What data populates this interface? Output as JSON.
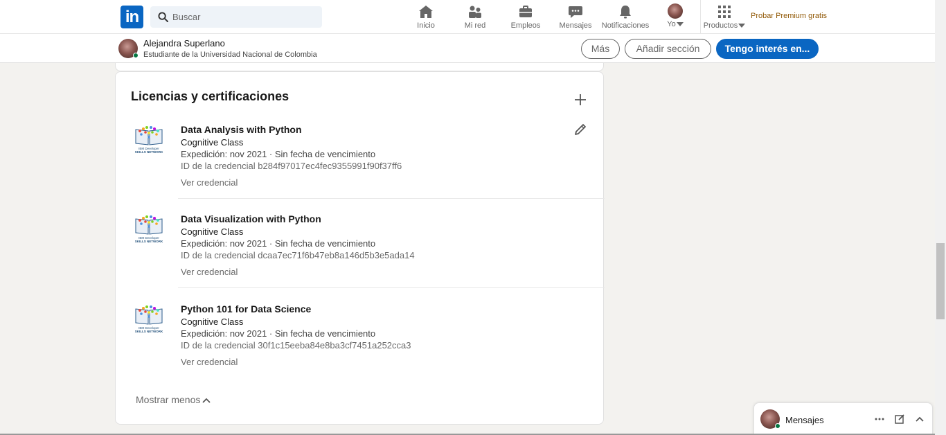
{
  "nav": {
    "logo": "in",
    "search_placeholder": "Buscar",
    "items": [
      {
        "label": "Inicio",
        "icon": "home-icon"
      },
      {
        "label": "Mi red",
        "icon": "network-icon"
      },
      {
        "label": "Empleos",
        "icon": "briefcase-icon"
      },
      {
        "label": "Mensajes",
        "icon": "messaging-icon"
      },
      {
        "label": "Notificaciones",
        "icon": "bell-icon"
      },
      {
        "label": "Yo",
        "icon": "avatar"
      },
      {
        "label": "Productos",
        "icon": "grid-icon"
      }
    ],
    "premium": "Probar Premium gratis"
  },
  "profile_bar": {
    "name": "Alejandra Superlano",
    "headline": "Estudiante de la Universidad Nacional de Colombia",
    "buttons": {
      "more": "Más",
      "add_section": "Añadir sección",
      "open_to": "Tengo interés en..."
    }
  },
  "section": {
    "title": "Licencias y certificaciones",
    "certifications": [
      {
        "name": "Data Analysis with Python",
        "issuer": "Cognitive Class",
        "issued": "Expedición: nov 2021 · Sin fecha de vencimiento",
        "credential_id": "ID de la credencial b284f97017ec4fec9355991f90f37ff6",
        "view": "Ver credencial"
      },
      {
        "name": "Data Visualization with Python",
        "issuer": "Cognitive Class",
        "issued": "Expedición: nov 2021 · Sin fecha de vencimiento",
        "credential_id": "ID de la credencial dcaa7ec71f6b47eb8a146d5b3e5ada14",
        "view": "Ver credencial"
      },
      {
        "name": "Python 101 for Data Science",
        "issuer": "Cognitive Class",
        "issued": "Expedición: nov 2021 · Sin fecha de vencimiento",
        "credential_id": "ID de la credencial 30f1c15eeba84e8ba3cf7451a252cca3",
        "view": "Ver credencial"
      }
    ],
    "show_less": "Mostrar menos"
  },
  "messaging": {
    "title": "Mensajes"
  },
  "colors": {
    "brand": "#0a66c2",
    "premium": "#915907",
    "online": "#057642"
  }
}
